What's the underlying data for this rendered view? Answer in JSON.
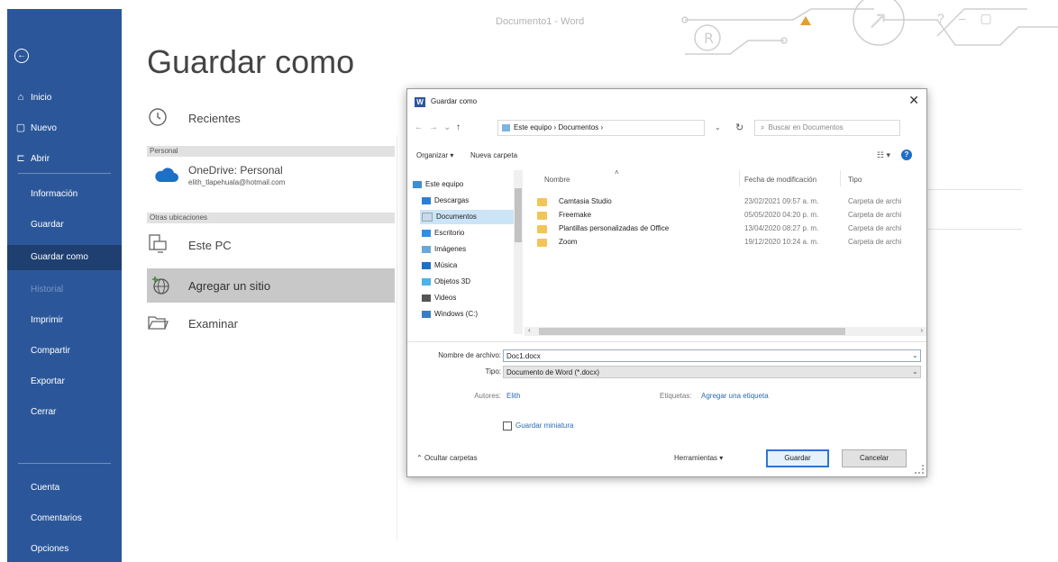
{
  "window": {
    "caption": "Documento1 - Word",
    "controls": "?  –  ▢"
  },
  "sidebar": {
    "back_icon": "back-arrow-icon",
    "top_items": [
      {
        "label": "Inicio",
        "icon": "home-icon"
      },
      {
        "label": "Nuevo",
        "icon": "new-document-icon"
      },
      {
        "label": "Abrir",
        "icon": "open-folder-icon"
      }
    ],
    "items": [
      {
        "label": "Información"
      },
      {
        "label": "Guardar"
      },
      {
        "label": "Guardar como",
        "active": true
      },
      {
        "label": "Historial",
        "disabled": true
      },
      {
        "label": "Imprimir"
      },
      {
        "label": "Compartir"
      },
      {
        "label": "Exportar"
      },
      {
        "label": "Cerrar"
      }
    ],
    "bottom_items": [
      {
        "label": "Cuenta"
      },
      {
        "label": "Comentarios"
      },
      {
        "label": "Opciones"
      }
    ],
    "color": "#2b579a",
    "active_color": "#1e3f70"
  },
  "backstage": {
    "title": "Guardar como",
    "recent_label": "Recientes",
    "personal_header": "Personal",
    "onedrive": {
      "name": "OneDrive: Personal",
      "email": "elith_tlapehuala@hotmail.com"
    },
    "other_header": "Otras ubicaciones",
    "this_pc": "Este PC",
    "add_site": "Agregar un sitio",
    "browse": "Examinar"
  },
  "dialog": {
    "title": "Guardar como",
    "close": "✕",
    "nav": {
      "back": "←",
      "forward": "→",
      "down": "⌄",
      "up": "↑",
      "path": "Este equipo  ›  Documentos  ›",
      "refresh": "↻",
      "search_placeholder": "Buscar en Documentos"
    },
    "toolbar": {
      "organize": "Organizar ▾",
      "new_folder": "Nueva carpeta",
      "view": "☷ ▾",
      "help": "?"
    },
    "tree": [
      {
        "label": "Este equipo",
        "color": "#3b8ed8"
      },
      {
        "label": "Descargas",
        "color": "#2a7fd4"
      },
      {
        "label": "Documentos",
        "color": "#c9d8ea",
        "selected": true
      },
      {
        "label": "Escritorio",
        "color": "#2f8fe0"
      },
      {
        "label": "Imágenes",
        "color": "#6aa8d9"
      },
      {
        "label": "Música",
        "color": "#1f6fc5"
      },
      {
        "label": "Objetos 3D",
        "color": "#4cb3e8"
      },
      {
        "label": "Videos",
        "color": "#555555"
      },
      {
        "label": "Windows (C:)",
        "color": "#3a7fc4"
      }
    ],
    "columns": {
      "name": "Nombre",
      "date": "Fecha de modificación",
      "type": "Tipo"
    },
    "files": [
      {
        "name": "Camtasia Studio",
        "date": "23/02/2021 09:57 a. m.",
        "type": "Carpeta de archi"
      },
      {
        "name": "Freemake",
        "date": "05/05/2020 04:20 p. m.",
        "type": "Carpeta de archi"
      },
      {
        "name": "Plantillas personalizadas de Office",
        "date": "13/04/2020 08:27 p. m.",
        "type": "Carpeta de archi"
      },
      {
        "name": "Zoom",
        "date": "19/12/2020 10:24 a. m.",
        "type": "Carpeta de archi"
      }
    ],
    "form": {
      "filename_label": "Nombre de archivo:",
      "filename_value": "Doc1.docx",
      "type_label": "Tipo:",
      "type_value": "Documento de Word (*.docx)",
      "authors_label": "Autores:",
      "authors_value": "Elith",
      "tags_label": "Etiquetas:",
      "tags_value": "Agregar una etiqueta",
      "thumbnail_label": "Guardar miniatura"
    },
    "footer": {
      "hide_folders": "Ocultar carpetas",
      "tools": "Herramientas",
      "save": "Guardar",
      "cancel": "Cancelar"
    }
  }
}
